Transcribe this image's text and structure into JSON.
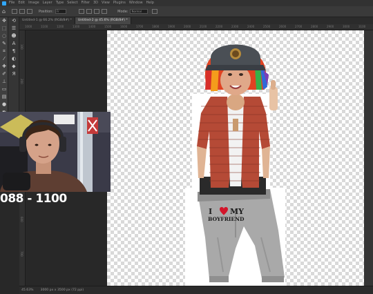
{
  "app": {
    "menu": [
      "File",
      "Edit",
      "Image",
      "Layer",
      "Type",
      "Select",
      "Filter",
      "3D",
      "View",
      "Plugins",
      "Window",
      "Help"
    ],
    "options": {
      "position_label": "Position:",
      "position_value": "Fr",
      "mode_label": "Mode:",
      "mode_value": "Normal"
    }
  },
  "tabs": [
    {
      "label": "Untitled-1 @ 66.2% (RGB/8#) *",
      "active": false
    },
    {
      "label": "Untitled-2 @ 45.6% (RGB/8#) *",
      "active": true
    }
  ],
  "rulers": {
    "top": [
      "1000",
      "1100",
      "1200",
      "1300",
      "1400",
      "1500",
      "1600",
      "1700",
      "1800",
      "1900",
      "2000",
      "2100",
      "2200",
      "2300",
      "2400",
      "2500",
      "2600",
      "2700",
      "2800",
      "2900",
      "3000",
      "3100"
    ],
    "left": [
      "100",
      "200",
      "300",
      "400",
      "500",
      "600",
      "700"
    ]
  },
  "status": {
    "zoom": "45.63%",
    "doc": "3000 px x 3500 px (72 ppi)"
  },
  "overlay": {
    "score_text": "088 - 1100"
  },
  "canvas_art": {
    "shirt_line1_a": "I",
    "shirt_line1_b": "MY",
    "shirt_line2": "BOYFRIEND"
  }
}
